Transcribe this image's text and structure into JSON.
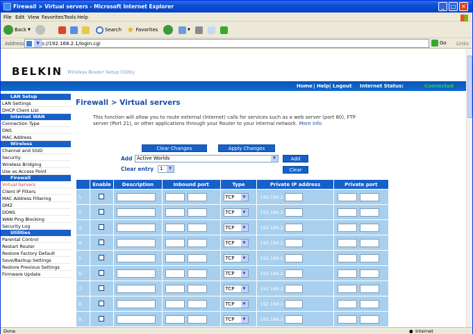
{
  "window": {
    "title": "Firewall > Virtual servers - Microsoft Internet Explorer"
  },
  "menu": [
    "File",
    "Edit",
    "View",
    "Favorites",
    "Tools",
    "Help"
  ],
  "toolbar": {
    "back": "Back",
    "search": "Search",
    "favorites": "Favorites"
  },
  "address": {
    "label": "Address",
    "url": "http://192.168.2.1/login.cgi",
    "go": "Go",
    "links": "Links"
  },
  "header": {
    "logo": "BELKIN",
    "tagline": "Wireless Router Setup Utility",
    "nav": {
      "home": "Home",
      "help": "Help",
      "logout": "Logout",
      "status_label": "Internet Status:",
      "status_value": "Connected"
    }
  },
  "sidebar": [
    {
      "type": "header",
      "label": "LAN Setup"
    },
    {
      "type": "item",
      "label": "LAN Settings"
    },
    {
      "type": "item",
      "label": "DHCP Client List"
    },
    {
      "type": "header",
      "label": "Internet WAN"
    },
    {
      "type": "item",
      "label": "Connection Type"
    },
    {
      "type": "item",
      "label": "DNS"
    },
    {
      "type": "item",
      "label": "MAC Address"
    },
    {
      "type": "header",
      "label": "Wireless"
    },
    {
      "type": "item",
      "label": "Channel and SSID"
    },
    {
      "type": "item",
      "label": "Security"
    },
    {
      "type": "item",
      "label": "Wireless Bridging"
    },
    {
      "type": "item",
      "label": "Use as Access Point"
    },
    {
      "type": "header",
      "label": "Firewall"
    },
    {
      "type": "item",
      "label": "Virtual Servers",
      "active": true
    },
    {
      "type": "item",
      "label": "Client IP Filters"
    },
    {
      "type": "item",
      "label": "MAC Address Filtering"
    },
    {
      "type": "item",
      "label": "DMZ"
    },
    {
      "type": "item",
      "label": "DDNS"
    },
    {
      "type": "item",
      "label": "WAN Ping Blocking"
    },
    {
      "type": "item",
      "label": "Security Log"
    },
    {
      "type": "header",
      "label": "Utilities"
    },
    {
      "type": "item",
      "label": "Parental Control"
    },
    {
      "type": "item",
      "label": "Restart Router"
    },
    {
      "type": "item",
      "label": "Restore Factory Default"
    },
    {
      "type": "item",
      "label": "Save/Backup Settings"
    },
    {
      "type": "item",
      "label": "Restore Previous Settings"
    },
    {
      "type": "item",
      "label": "Firmware Update"
    }
  ],
  "page": {
    "title": "Firewall > Virtual servers",
    "description": "This function will allow you to route external (Internet) calls for services such as a web server (port 80), FTP server (Port 21), or other applications through your Router to your internal network.",
    "more_info": "More Info",
    "clear_changes": "Clear Changes",
    "apply_changes": "Apply Changes",
    "add_label": "Add",
    "add_value": "Active Worlds",
    "add_button": "Add",
    "clear_entry_label": "Clear entry",
    "clear_entry_value": "1",
    "clear_button": "Clear"
  },
  "table": {
    "headers": [
      "Enable",
      "Description",
      "Inbound port",
      "Type",
      "Private IP address",
      "Private port"
    ],
    "rows": [
      {
        "num": "1.",
        "type": "TCP",
        "ip_prefix": "192.168.2."
      },
      {
        "num": "2.",
        "type": "TCP",
        "ip_prefix": "192.168.2."
      },
      {
        "num": "3.",
        "type": "TCP",
        "ip_prefix": "192.168.2."
      },
      {
        "num": "4.",
        "type": "TCP",
        "ip_prefix": "192.168.2."
      },
      {
        "num": "5.",
        "type": "TCP",
        "ip_prefix": "192.168.2."
      },
      {
        "num": "6.",
        "type": "TCP",
        "ip_prefix": "192.168.2."
      },
      {
        "num": "7.",
        "type": "TCP",
        "ip_prefix": "192.168.2."
      },
      {
        "num": "8.",
        "type": "TCP",
        "ip_prefix": "192.168.2."
      },
      {
        "num": "9.",
        "type": "TCP",
        "ip_prefix": "192.168.2."
      }
    ]
  },
  "status": {
    "left": "Done",
    "right": "Internet"
  }
}
